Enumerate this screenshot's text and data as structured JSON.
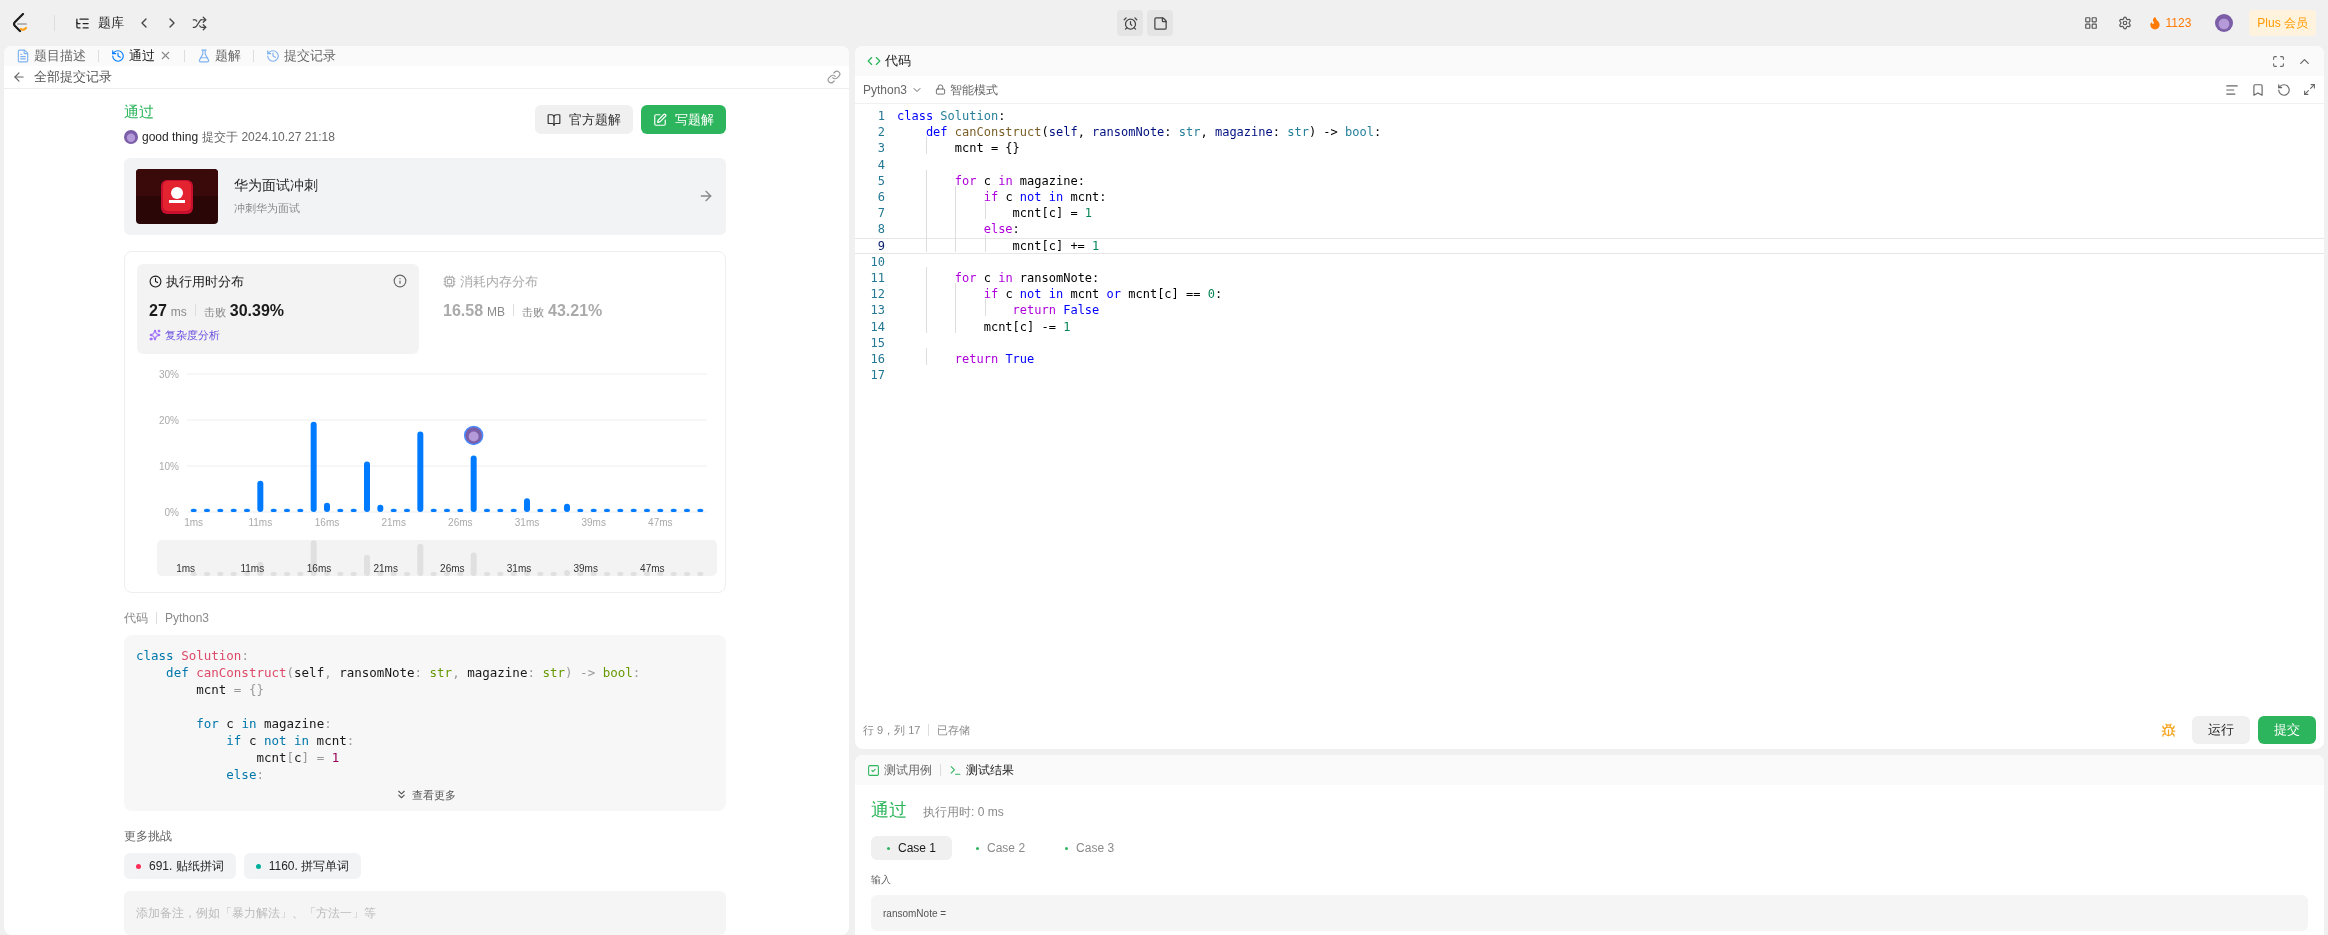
{
  "top_bar": {
    "nav_label": "题库",
    "streak": "1123",
    "plus_button": "Plus 会员"
  },
  "left_tabs": [
    {
      "label": "题目描述",
      "selected": false,
      "closable": false
    },
    {
      "label": "通过",
      "selected": true,
      "closable": true
    },
    {
      "label": "题解",
      "selected": false,
      "closable": false
    },
    {
      "label": "提交记录",
      "selected": false,
      "closable": false
    }
  ],
  "back_link": "全部提交记录",
  "submission": {
    "status": "通过",
    "user": "good thing",
    "submitted_label": "提交于",
    "submitted_at": "2024.10.27 21:18",
    "buttons": [
      {
        "label": "官方题解",
        "kind": "secondary"
      },
      {
        "label": "写题解",
        "kind": "primary"
      }
    ]
  },
  "promo": {
    "title": "华为面试冲刺",
    "subtitle": "冲刺华为面试"
  },
  "stats": [
    {
      "title": "执行用时分布",
      "value": "27",
      "unit": "ms",
      "beat_label": "击败",
      "beat": "30.39%",
      "selected": true,
      "link": "复杂度分析"
    },
    {
      "title": "消耗内存分布",
      "value": "16.58",
      "unit": "MB",
      "beat_label": "击败",
      "beat": "43.21%",
      "selected": false
    }
  ],
  "chart_data": {
    "type": "bar",
    "categories": [
      "1ms",
      null,
      null,
      null,
      null,
      "11ms",
      null,
      null,
      null,
      null,
      "16ms",
      null,
      null,
      null,
      null,
      "21ms",
      null,
      null,
      null,
      null,
      "26ms",
      null,
      null,
      null,
      null,
      "31ms",
      null,
      null,
      null,
      null,
      "39ms",
      null,
      null,
      null,
      null,
      "47ms",
      null,
      null,
      null
    ],
    "series": [
      {
        "color": "#007aff",
        "values": [
          0.7,
          0.7,
          0.7,
          0.7,
          0.7,
          6.8,
          0.7,
          0.7,
          0.7,
          19.6,
          2.0,
          0.7,
          0.7,
          11.0,
          1.6,
          0.7,
          0.7,
          17.5,
          0.7,
          0.7,
          0.7,
          12.3,
          0.7,
          0.7,
          0.7,
          3.0,
          0.7,
          0.7,
          1.8,
          0.7,
          0.7,
          0.7,
          0.7,
          0.7,
          0.7,
          0.7,
          0.7,
          0.7,
          0.7
        ]
      }
    ],
    "ylim": [
      0,
      30
    ],
    "yticks": [
      {
        "value": 0,
        "label": "0%"
      },
      {
        "value": 10,
        "label": "10%"
      },
      {
        "value": 20,
        "label": "20%"
      },
      {
        "value": 30,
        "label": "30%"
      }
    ]
  },
  "brush_labels": [
    "1ms",
    "11ms",
    "16ms",
    "21ms",
    "26ms",
    "31ms",
    "39ms",
    "47ms"
  ],
  "code_section": {
    "label": "代码",
    "language": "Python3",
    "more": "查看更多",
    "lines": [
      {
        "space_before": false,
        "tokens": [
          {
            "kind": "kw",
            "text": "class "
          },
          {
            "kind": "cls",
            "text": "Solution"
          },
          {
            "kind": "punct",
            "text": ":"
          }
        ]
      },
      {
        "space_before": false,
        "tokens": [
          {
            "kind": "kw",
            "text": "    def "
          },
          {
            "kind": "fn",
            "text": "canConstruct"
          },
          {
            "kind": "punct",
            "text": "("
          },
          {
            "kind": "plain",
            "text": "self"
          },
          {
            "kind": "punct",
            "text": ", "
          },
          {
            "kind": "plain",
            "text": "ransomNote"
          },
          {
            "kind": "punct",
            "text": ": "
          },
          {
            "kind": "type",
            "text": "str"
          },
          {
            "kind": "punct",
            "text": ", "
          },
          {
            "kind": "plain",
            "text": "magazine"
          },
          {
            "kind": "punct",
            "text": ": "
          },
          {
            "kind": "type",
            "text": "str"
          },
          {
            "kind": "punct",
            "text": ") -> "
          },
          {
            "kind": "type",
            "text": "bool"
          },
          {
            "kind": "punct",
            "text": ":"
          }
        ]
      },
      {
        "space_before": false,
        "tokens": [
          {
            "kind": "plain",
            "text": "        mcnt "
          },
          {
            "kind": "punct",
            "text": "= {}"
          }
        ]
      },
      {
        "space_before": true,
        "tokens": [
          {
            "kind": "kw",
            "text": "        for"
          },
          {
            "kind": "plain",
            "text": " c "
          },
          {
            "kind": "kw",
            "text": "in"
          },
          {
            "kind": "plain",
            "text": " magazine"
          },
          {
            "kind": "punct",
            "text": ":"
          }
        ]
      },
      {
        "space_before": false,
        "tokens": [
          {
            "kind": "kw",
            "text": "            if"
          },
          {
            "kind": "plain",
            "text": " c "
          },
          {
            "kind": "kw",
            "text": "not in"
          },
          {
            "kind": "plain",
            "text": " mcnt"
          },
          {
            "kind": "punct",
            "text": ":"
          }
        ]
      },
      {
        "space_before": false,
        "tokens": [
          {
            "kind": "plain",
            "text": "                mcnt"
          },
          {
            "kind": "punct",
            "text": "["
          },
          {
            "kind": "plain",
            "text": "c"
          },
          {
            "kind": "punct",
            "text": "] = "
          },
          {
            "kind": "num",
            "text": "1"
          }
        ]
      },
      {
        "space_before": false,
        "tokens": [
          {
            "kind": "kw",
            "text": "            else"
          },
          {
            "kind": "punct",
            "text": ":"
          }
        ]
      }
    ]
  },
  "more_challenges": {
    "title": "更多挑战",
    "items": [
      {
        "label": "691. 贴纸拼词",
        "color": "#ff2d55"
      },
      {
        "label": "1160. 拼写单词",
        "color": "#00af9b"
      }
    ]
  },
  "note": {
    "placeholder": "添加备注，例如「暴力解法」、「方法一」等"
  },
  "editor": {
    "title": "代码",
    "language": "Python3",
    "mode": "智能模式",
    "lines": [
      {
        "no": "1",
        "current": false,
        "tokens": [
          {
            "kind": "kw",
            "text": "class "
          },
          {
            "kind": "cls",
            "text": "Solution"
          },
          {
            "kind": "plain",
            "text": ":"
          }
        ]
      },
      {
        "no": "2",
        "current": false,
        "tokens": [
          {
            "kind": "kw",
            "text": "    def "
          },
          {
            "kind": "fn",
            "text": "canConstruct"
          },
          {
            "kind": "plain",
            "text": "("
          },
          {
            "kind": "param",
            "text": "self"
          },
          {
            "kind": "plain",
            "text": ", "
          },
          {
            "kind": "param",
            "text": "ransomNote"
          },
          {
            "kind": "plain",
            "text": ": "
          },
          {
            "kind": "type",
            "text": "str"
          },
          {
            "kind": "plain",
            "text": ", "
          },
          {
            "kind": "param",
            "text": "magazine"
          },
          {
            "kind": "plain",
            "text": ": "
          },
          {
            "kind": "type",
            "text": "str"
          },
          {
            "kind": "plain",
            "text": ") -> "
          },
          {
            "kind": "type",
            "text": "bool"
          },
          {
            "kind": "plain",
            "text": ":"
          }
        ]
      },
      {
        "no": "3",
        "current": false,
        "tokens": [
          {
            "kind": "plain",
            "text": "        mcnt = {}"
          }
        ]
      },
      {
        "no": "4",
        "current": false
      },
      {
        "no": "5",
        "current": false,
        "tokens": [
          {
            "kind": "ctrl",
            "text": "        for"
          },
          {
            "kind": "plain",
            "text": " c "
          },
          {
            "kind": "ctrl",
            "text": "in"
          },
          {
            "kind": "plain",
            "text": " magazine:"
          }
        ]
      },
      {
        "no": "6",
        "current": false,
        "tokens": [
          {
            "kind": "ctrl",
            "text": "            if"
          },
          {
            "kind": "plain",
            "text": " c "
          },
          {
            "kind": "kw",
            "text": "not in"
          },
          {
            "kind": "plain",
            "text": " mcnt:"
          }
        ]
      },
      {
        "no": "7",
        "current": false,
        "tokens": [
          {
            "kind": "plain",
            "text": "                mcnt[c] = "
          },
          {
            "kind": "num",
            "text": "1"
          }
        ]
      },
      {
        "no": "8",
        "current": false,
        "tokens": [
          {
            "kind": "ctrl",
            "text": "            else"
          },
          {
            "kind": "plain",
            "text": ":"
          }
        ]
      },
      {
        "no": "9",
        "current": true,
        "tokens": [
          {
            "kind": "plain",
            "text": "                mcnt[c] += "
          },
          {
            "kind": "num",
            "text": "1"
          }
        ]
      },
      {
        "no": "10",
        "current": false
      },
      {
        "no": "11",
        "current": false,
        "tokens": [
          {
            "kind": "ctrl",
            "text": "        for"
          },
          {
            "kind": "plain",
            "text": " c "
          },
          {
            "kind": "ctrl",
            "text": "in"
          },
          {
            "kind": "plain",
            "text": " ransomNote:"
          }
        ]
      },
      {
        "no": "12",
        "current": false,
        "tokens": [
          {
            "kind": "ctrl",
            "text": "            if"
          },
          {
            "kind": "plain",
            "text": " c "
          },
          {
            "kind": "kw",
            "text": "not in"
          },
          {
            "kind": "plain",
            "text": " mcnt "
          },
          {
            "kind": "kw",
            "text": "or"
          },
          {
            "kind": "plain",
            "text": " mcnt[c] == "
          },
          {
            "kind": "num",
            "text": "0"
          },
          {
            "kind": "plain",
            "text": ":"
          }
        ]
      },
      {
        "no": "13",
        "current": false,
        "tokens": [
          {
            "kind": "ctrl",
            "text": "                return"
          },
          {
            "kind": "kw",
            "text": " False"
          }
        ]
      },
      {
        "no": "14",
        "current": false,
        "tokens": [
          {
            "kind": "plain",
            "text": "            mcnt[c] -= "
          },
          {
            "kind": "num",
            "text": "1"
          }
        ]
      },
      {
        "no": "15",
        "current": false
      },
      {
        "no": "16",
        "current": false,
        "tokens": [
          {
            "kind": "ctrl",
            "text": "        return"
          },
          {
            "kind": "kw",
            "text": " True"
          }
        ]
      },
      {
        "no": "17",
        "current": false
      }
    ],
    "status": {
      "cursor": "行 9，列 17",
      "saved": "已存储"
    },
    "buttons": [
      {
        "label": "运行",
        "kind": "secondary"
      },
      {
        "label": "提交",
        "kind": "primary"
      }
    ]
  },
  "console": {
    "tabs": [
      {
        "label": "测试用例",
        "selected": false
      },
      {
        "label": "测试结果",
        "selected": true
      }
    ],
    "status": "通过",
    "runtime": "执行用时: 0 ms",
    "cases": [
      {
        "label": "Case 1",
        "selected": true
      },
      {
        "label": "Case 2",
        "selected": false
      },
      {
        "label": "Case 3",
        "selected": false
      }
    ],
    "input_label": "输入",
    "input_name": "ransomNote ="
  }
}
